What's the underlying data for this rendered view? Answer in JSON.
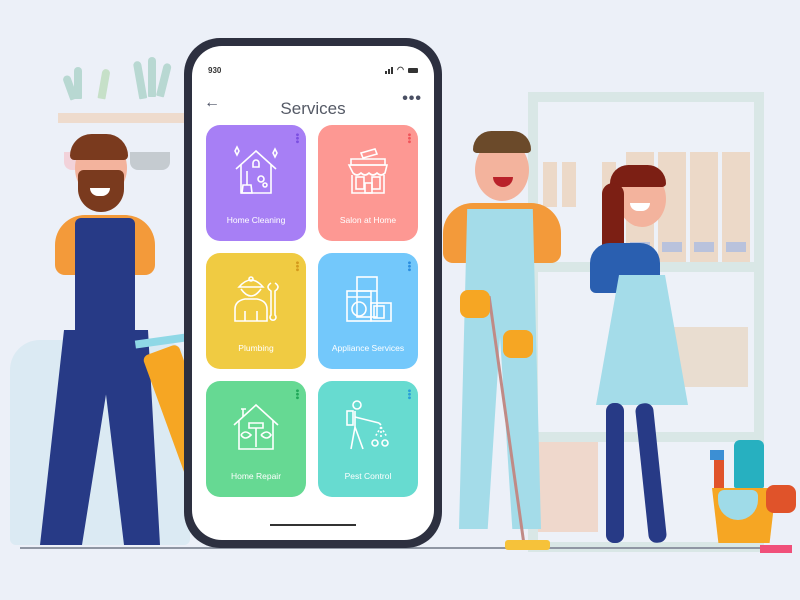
{
  "scene": {
    "description": "Illustration of home service workers beside a phone showing a services app",
    "background_color": "#ecf0f8"
  },
  "phone": {
    "status_bar": {
      "time": "930",
      "signal_icon": "signal-icon",
      "wifi_icon": "wifi-icon",
      "battery_icon": "battery-icon"
    },
    "nav": {
      "back_icon": "←",
      "title": "Services",
      "more_icon": "•••"
    },
    "services": [
      {
        "label": "Home Cleaning",
        "color": "#a77ff5",
        "kebab_color": "#7b4fe0",
        "icon": "house-broom-icon"
      },
      {
        "label": "Salon at Home",
        "color": "#fd9893",
        "kebab_color": "#f0555a",
        "icon": "salon-shop-icon"
      },
      {
        "label": "Plumbing",
        "color": "#f0cb42",
        "kebab_color": "#d49a1c",
        "icon": "plumber-wrench-icon"
      },
      {
        "label": "Appliance Services",
        "color": "#73c8fb",
        "kebab_color": "#2b8ee0",
        "icon": "appliances-icon"
      },
      {
        "label": "Home Repair",
        "color": "#66d993",
        "kebab_color": "#22a85a",
        "icon": "house-tools-icon"
      },
      {
        "label": "Pest Control",
        "color": "#67dbd0",
        "kebab_color": "#2a9fd8",
        "icon": "pest-sprayer-icon"
      }
    ]
  }
}
